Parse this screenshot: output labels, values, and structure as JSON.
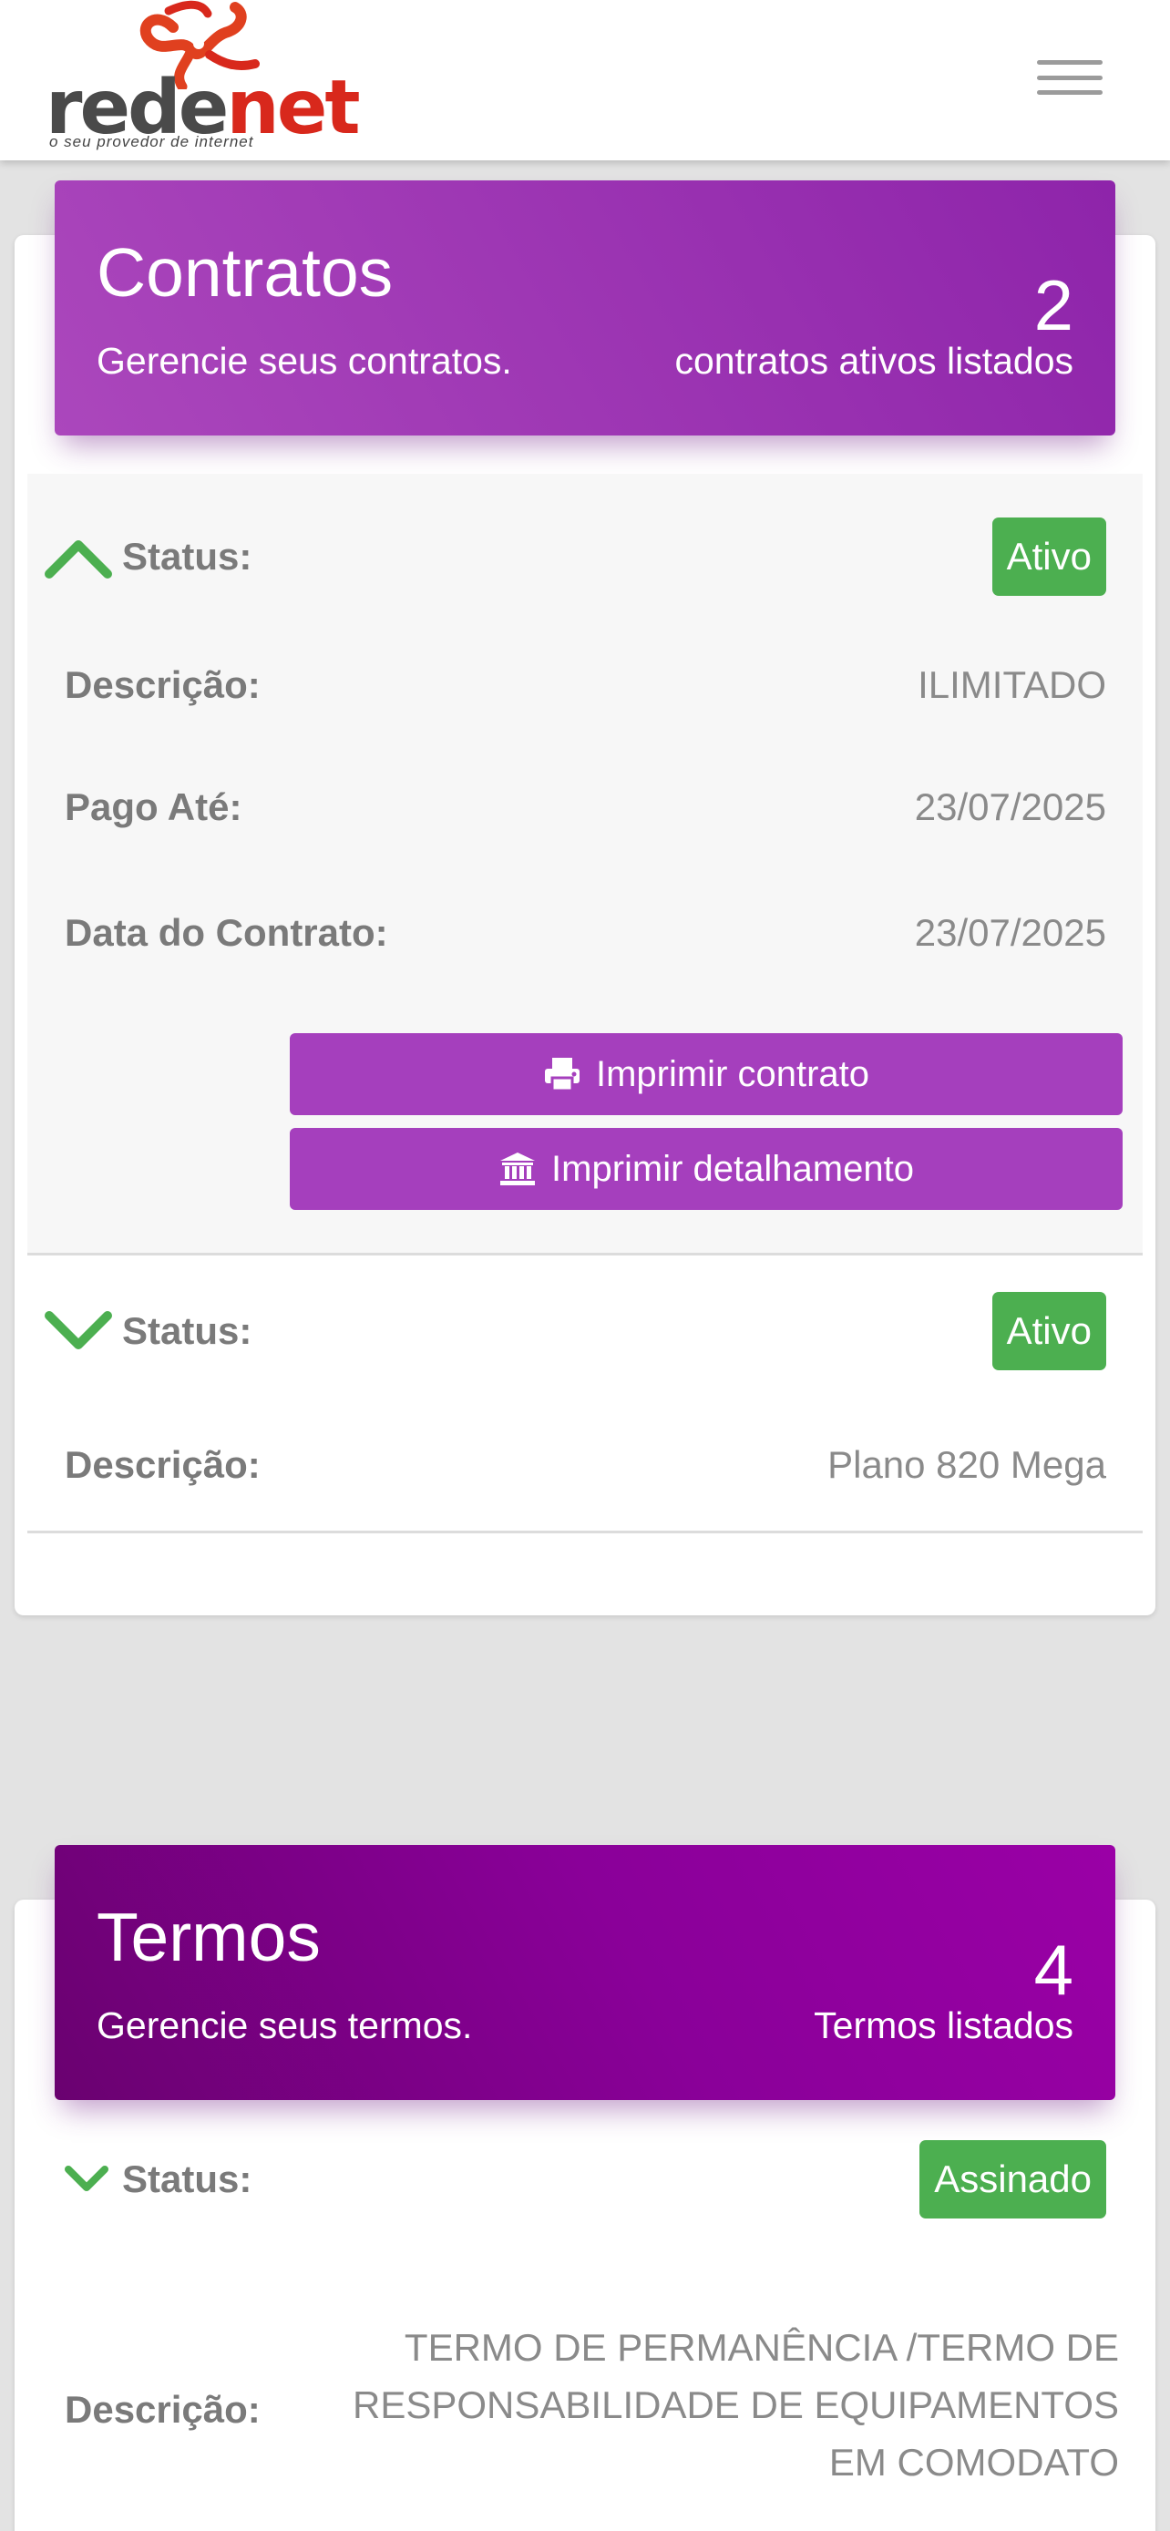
{
  "app": {
    "logo": {
      "word_part1": "rede",
      "word_part2": "net",
      "tagline": "o seu provedor de internet"
    },
    "menu_icon": "hamburger-menu-icon"
  },
  "colors": {
    "contratos_header": "#9c3bb8",
    "termos_header": "#7d0085",
    "active_badge": "#4caf50",
    "button": "#a53fbd",
    "chevron": "#4caf50"
  },
  "contratos": {
    "title": "Contratos",
    "subtitle": "Gerencie seus contratos.",
    "count": "2",
    "count_label": "contratos ativos listados",
    "items": [
      {
        "expanded": true,
        "status_label": "Status:",
        "status": "Ativo",
        "fields": [
          {
            "label": "Descrição:",
            "value": "ILIMITADO"
          },
          {
            "label": "Pago Até:",
            "value": "23/07/2025"
          },
          {
            "label": "Data do Contrato:",
            "value": "23/07/2025"
          }
        ],
        "buttons": [
          {
            "label": "Imprimir contrato",
            "icon": "printer-icon"
          },
          {
            "label": "Imprimir detalhamento",
            "icon": "bank-icon"
          }
        ]
      },
      {
        "expanded": false,
        "status_label": "Status:",
        "status": "Ativo",
        "fields": [
          {
            "label": "Descrição:",
            "value": "Plano 820 Mega"
          }
        ]
      }
    ]
  },
  "termos": {
    "title": "Termos",
    "subtitle": "Gerencie seus termos.",
    "count": "4",
    "count_label": "Termos listados",
    "items": [
      {
        "status_label": "Status:",
        "status": "Assinado",
        "description_label": "Descrição:",
        "description": "TERMO DE PERMANÊNCIA /TERMO DE RESPONSABILIDADE DE EQUIPAMENTOS EM COMODATO"
      }
    ]
  }
}
